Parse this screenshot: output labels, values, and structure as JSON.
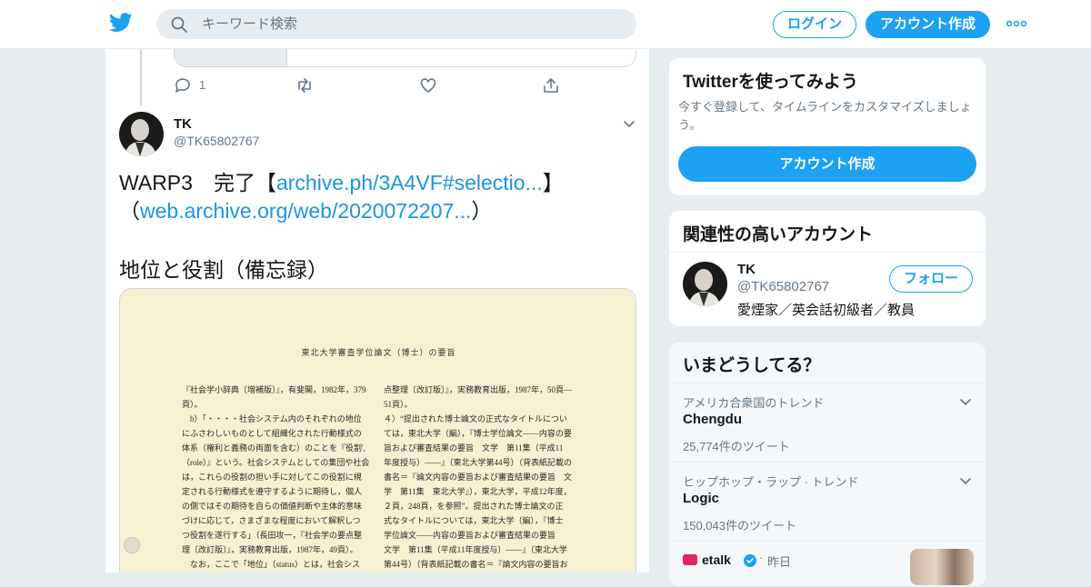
{
  "header": {
    "search_placeholder": "キーワード検索",
    "login_label": "ログイン",
    "signup_label": "アカウント作成"
  },
  "prev_tweet": {
    "reply_count": "1"
  },
  "tweet": {
    "name": "TK",
    "handle": "@TK65802767",
    "text_part1": "WARP3　完了【",
    "link1": "archive.ph/3A4VF#selectio...",
    "text_part2": "】（",
    "link2": "web.archive.org/web/2020072207...",
    "text_part3": "）",
    "text_line2": "地位と役割（備忘録）",
    "image": {
      "heading": "東北大学審査学位論文（博士）の要旨",
      "left_column": [
        "『社会学小辞典〔増補版〕』，有斐閣，1982年，379",
        "頁）。",
        "　b）「・・・・社会システム内のそれぞれの地位",
        "にふさわしいものとして組織化された行動様式の",
        "体系（権利と義務の両面を含む）のことを『役割',",
        "（role）』という。社会システムとしての集団や社会",
        "は，これらの役割の担い手に対してこの役割に規",
        "定される行動様式を遵守するように期待し，個人",
        "の側ではその期待を自らの価値判断や主体的意味",
        "づけに応じて，さまざまな程度において解釈しつ",
        "つ役割を遂行する」（長田攻一，『社会学の要点整",
        "理〔改訂版〕』，実務教育出版，1987年，49頁）。",
        "　なお，ここで「地位」（status）とは，社会シス"
      ],
      "right_column": [
        "点整理〔改訂版〕』，実務教育出版，1987年，50頁―",
        "51頁）。",
        "４）“提出された博士論文の正式なタイトルについ",
        "ては，東北大学（編），『博士学位論文――内容の要",
        "旨および審査結果の要旨　文学　第11集（平成11",
        "年度授与）――』（東北大学第44号）（背表紙記載の",
        "書名＝『論文内容の要旨および審査結果の要旨　文",
        "学　第11集　東北大学』），東北大学，平成12年度，",
        "２頁，248頁，を参照”。提出された博士論文の正",
        "式なタイトルについては，東北大学（編），『博士",
        "学位論文――内容の要旨および審査結果の要旨",
        "文学　第11集（平成11年度授与）――』（東北大学",
        "第44号）（背表紙記載の書名＝『論文内容の要旨お"
      ]
    }
  },
  "signup_card": {
    "title": "Twitterを使ってみよう",
    "description": "今すぐ登録して、タイムラインをカスタマイズしましょう。",
    "button": "アカウント作成"
  },
  "related_card": {
    "title": "関連性の高いアカウント",
    "name": "TK",
    "handle": "@TK65802767",
    "bio": "愛煙家／英会話初級者／教員",
    "follow": "フォロー"
  },
  "trends_card": {
    "title": "いまどうしてる？",
    "trends": [
      {
        "context": "アメリカ合衆国のトレンド",
        "name": "Chengdu",
        "count": "25,774件のツイート"
      },
      {
        "context": "ヒップホップ・ラップ · トレンド",
        "name": "Logic",
        "count": "150,043件のツイート"
      }
    ],
    "story": {
      "source": "etalk",
      "time": "昨日"
    }
  },
  "colors": {
    "accent": "#1da1f2",
    "link": "#1b95e0",
    "muted": "#657786",
    "background": "#e6ecf0"
  }
}
